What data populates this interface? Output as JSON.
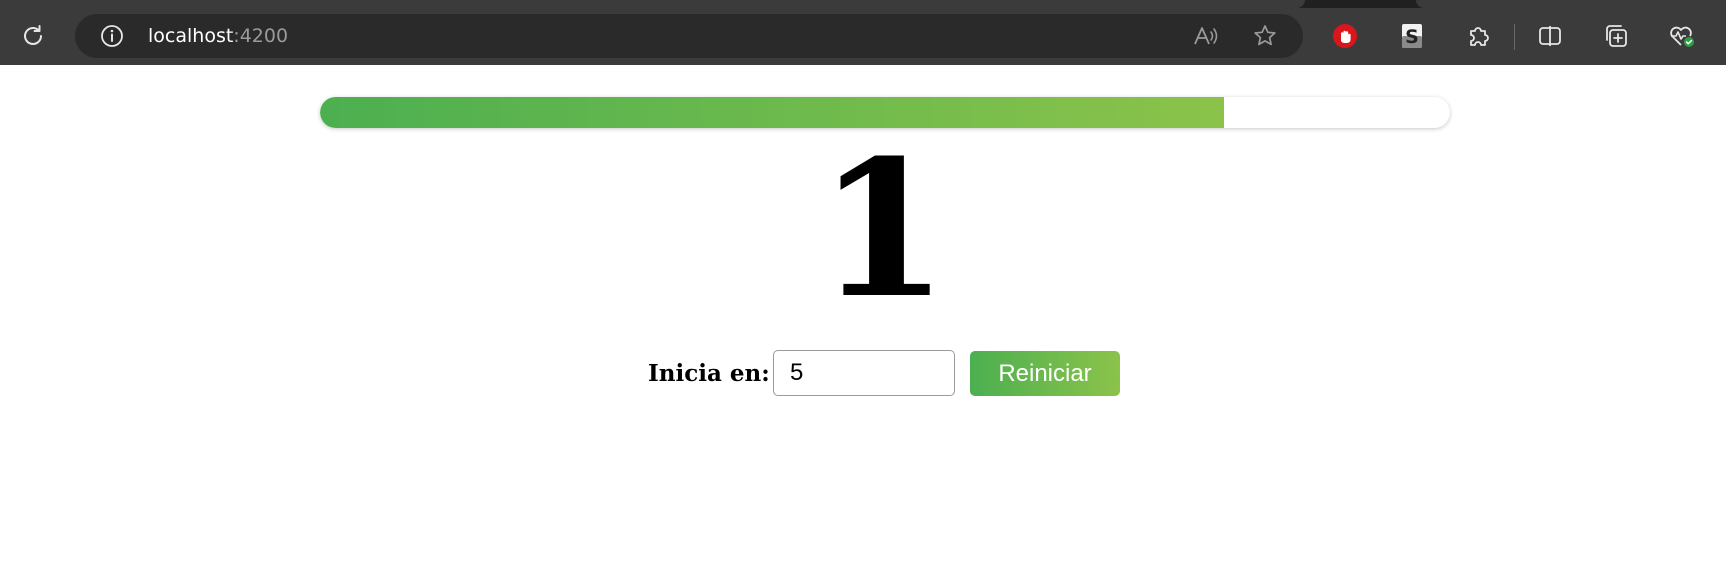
{
  "browser": {
    "url_host": "localhost",
    "url_port": ":4200",
    "icons": {
      "reload": "reload-icon",
      "site_info": "info-icon",
      "read_aloud": "read-aloud-icon",
      "favorite": "star-icon",
      "ext_adblock": "stop-hand-icon",
      "ext_s": "s-extension-icon",
      "extensions": "puzzle-icon",
      "split_screen": "split-screen-icon",
      "collections": "collections-icon",
      "browser_essentials": "heartbeat-icon"
    }
  },
  "progress": {
    "fraction": 0.8,
    "gradient_start": "#4caf50",
    "gradient_end": "#8bc34a"
  },
  "counter": {
    "value": "1"
  },
  "controls": {
    "start_label": "Inicia en:",
    "start_value": "5",
    "reset_label": "Reiniciar",
    "button_gradient_start": "#4caf50",
    "button_gradient_end": "#8bc34a"
  }
}
